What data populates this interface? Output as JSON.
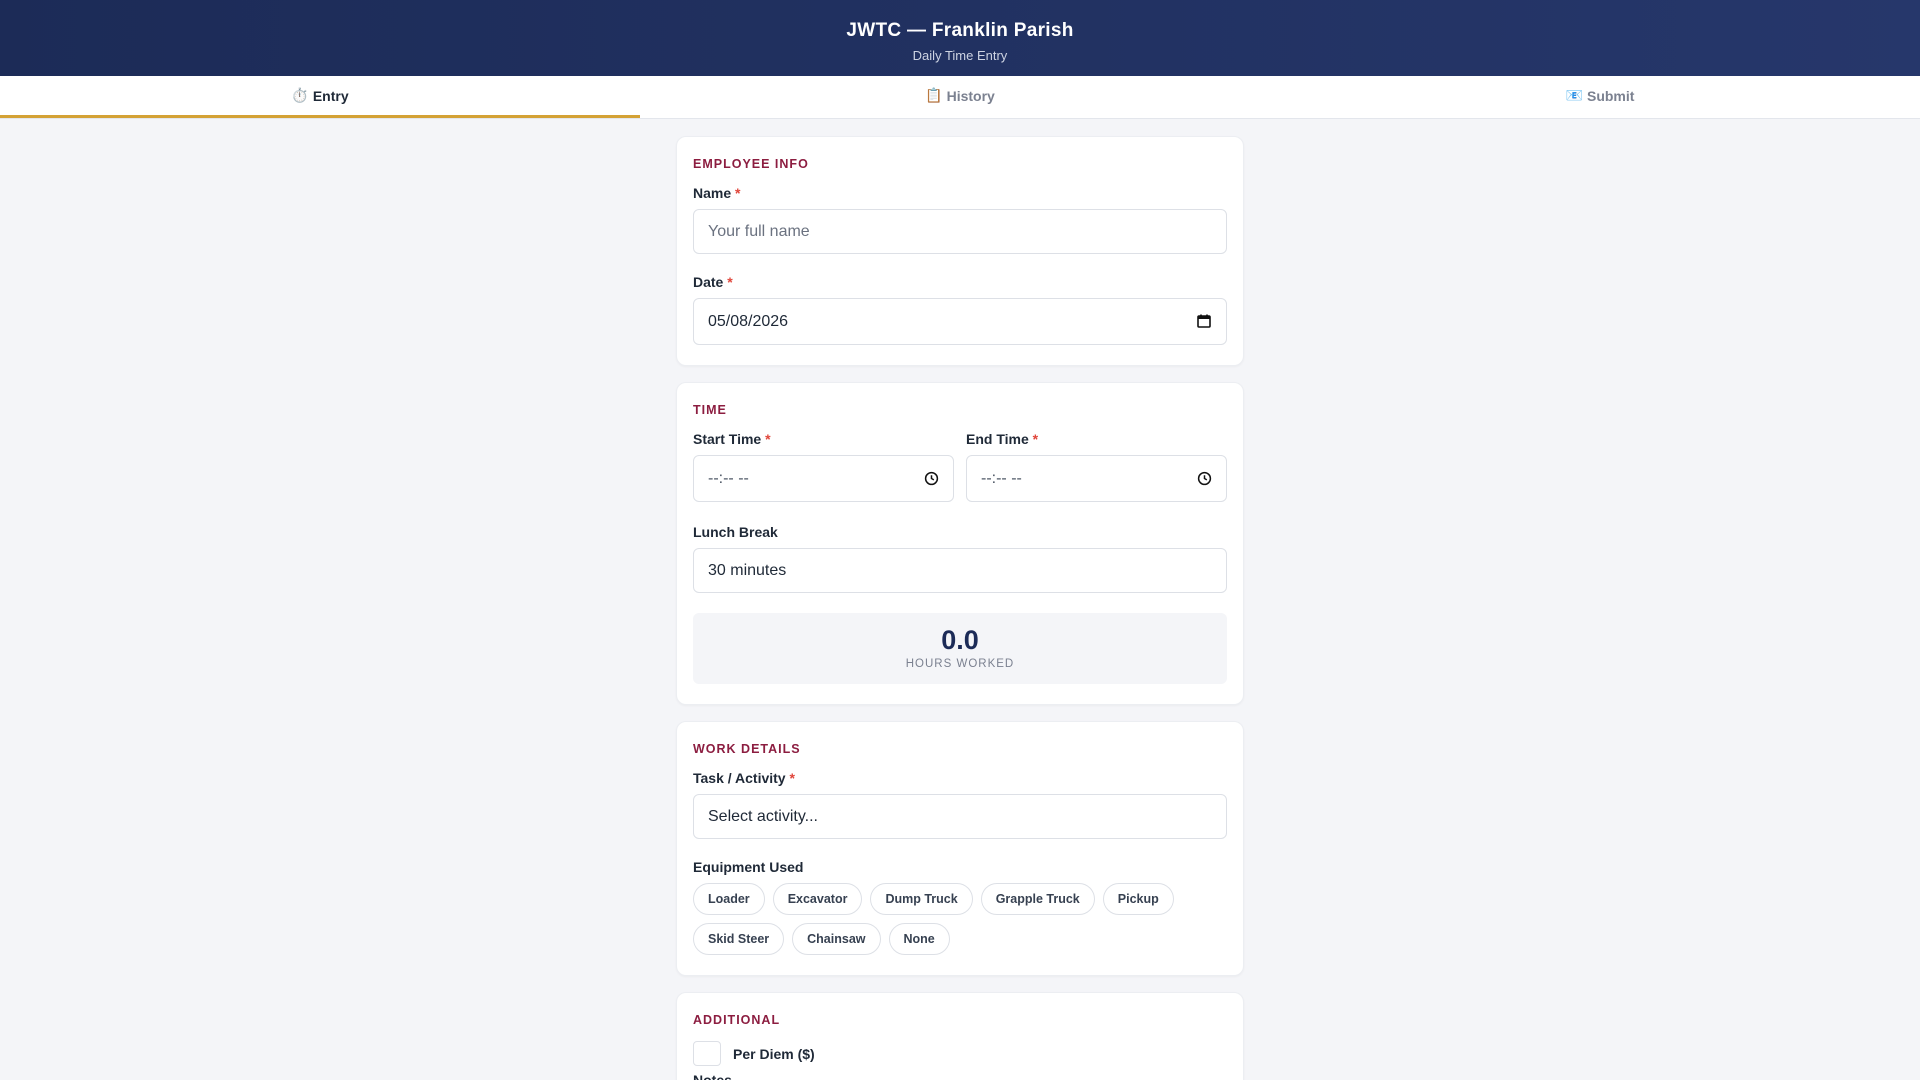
{
  "header": {
    "title": "JWTC — Franklin Parish",
    "subtitle": "Daily Time Entry"
  },
  "tabs": [
    {
      "icon": "⏱️",
      "label": "Entry",
      "active": true
    },
    {
      "icon": "📋",
      "label": "History",
      "active": false
    },
    {
      "icon": "📧",
      "label": "Submit",
      "active": false
    }
  ],
  "employee": {
    "section_title": "EMPLOYEE INFO",
    "name_label": "Name",
    "name_placeholder": "Your full name",
    "date_label": "Date",
    "date_value": "05/08/2026",
    "required_mark": "*"
  },
  "time": {
    "section_title": "TIME",
    "start_label": "Start Time",
    "start_value": "--:-- --",
    "end_label": "End Time",
    "end_value": "--:-- --",
    "lunch_label": "Lunch Break",
    "lunch_value": "30 minutes",
    "hours_value": "0.0",
    "hours_label": "HOURS WORKED"
  },
  "work": {
    "section_title": "WORK DETAILS",
    "task_label": "Task / Activity",
    "task_value": "Select activity...",
    "equipment_label": "Equipment Used",
    "equipment": [
      "Loader",
      "Excavator",
      "Dump Truck",
      "Grapple Truck",
      "Pickup",
      "Skid Steer",
      "Chainsaw",
      "None"
    ]
  },
  "additional": {
    "section_title": "ADDITIONAL",
    "per_diem_label": "Per Diem ($)",
    "notes_label": "Notes"
  },
  "colors": {
    "header_bg": "#1c2b57",
    "accent": "#d4a235",
    "section_title": "#8c1d40",
    "required": "#e0453a"
  }
}
